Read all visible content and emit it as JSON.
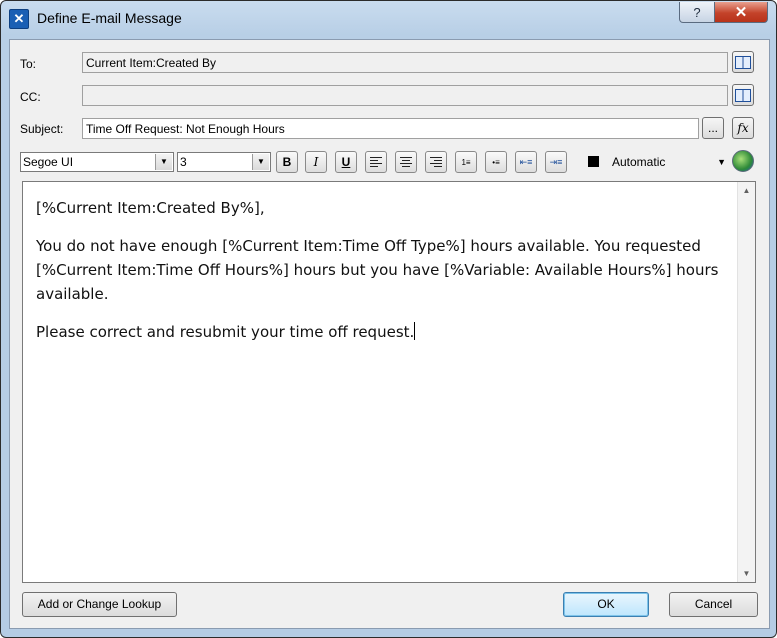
{
  "window": {
    "title": "Define E-mail Message",
    "help_glyph": "?",
    "close_glyph": "✕"
  },
  "fields": {
    "to_label": "To:",
    "to_value": "Current Item:Created By",
    "cc_label": "CC:",
    "cc_value": "",
    "subject_label": "Subject:",
    "subject_value": "Time Off Request: Not Enough Hours",
    "ellipsis_label": "...",
    "fx_label": "fx"
  },
  "toolbar": {
    "font": "Segoe UI",
    "size": "3",
    "bold": "B",
    "italic": "I",
    "underline": "U",
    "color_label": "Automatic",
    "color_value": "#000000"
  },
  "body": {
    "line1": "[%Current Item:Created By%],",
    "line2": "You do not have enough [%Current Item:Time Off Type%] hours available. You requested [%Current Item:Time Off Hours%] hours but you have [%Variable: Available Hours%] hours available.",
    "line3": "Please correct and resubmit your time off request."
  },
  "buttons": {
    "lookup": "Add or Change Lookup",
    "ok": "OK",
    "cancel": "Cancel"
  }
}
